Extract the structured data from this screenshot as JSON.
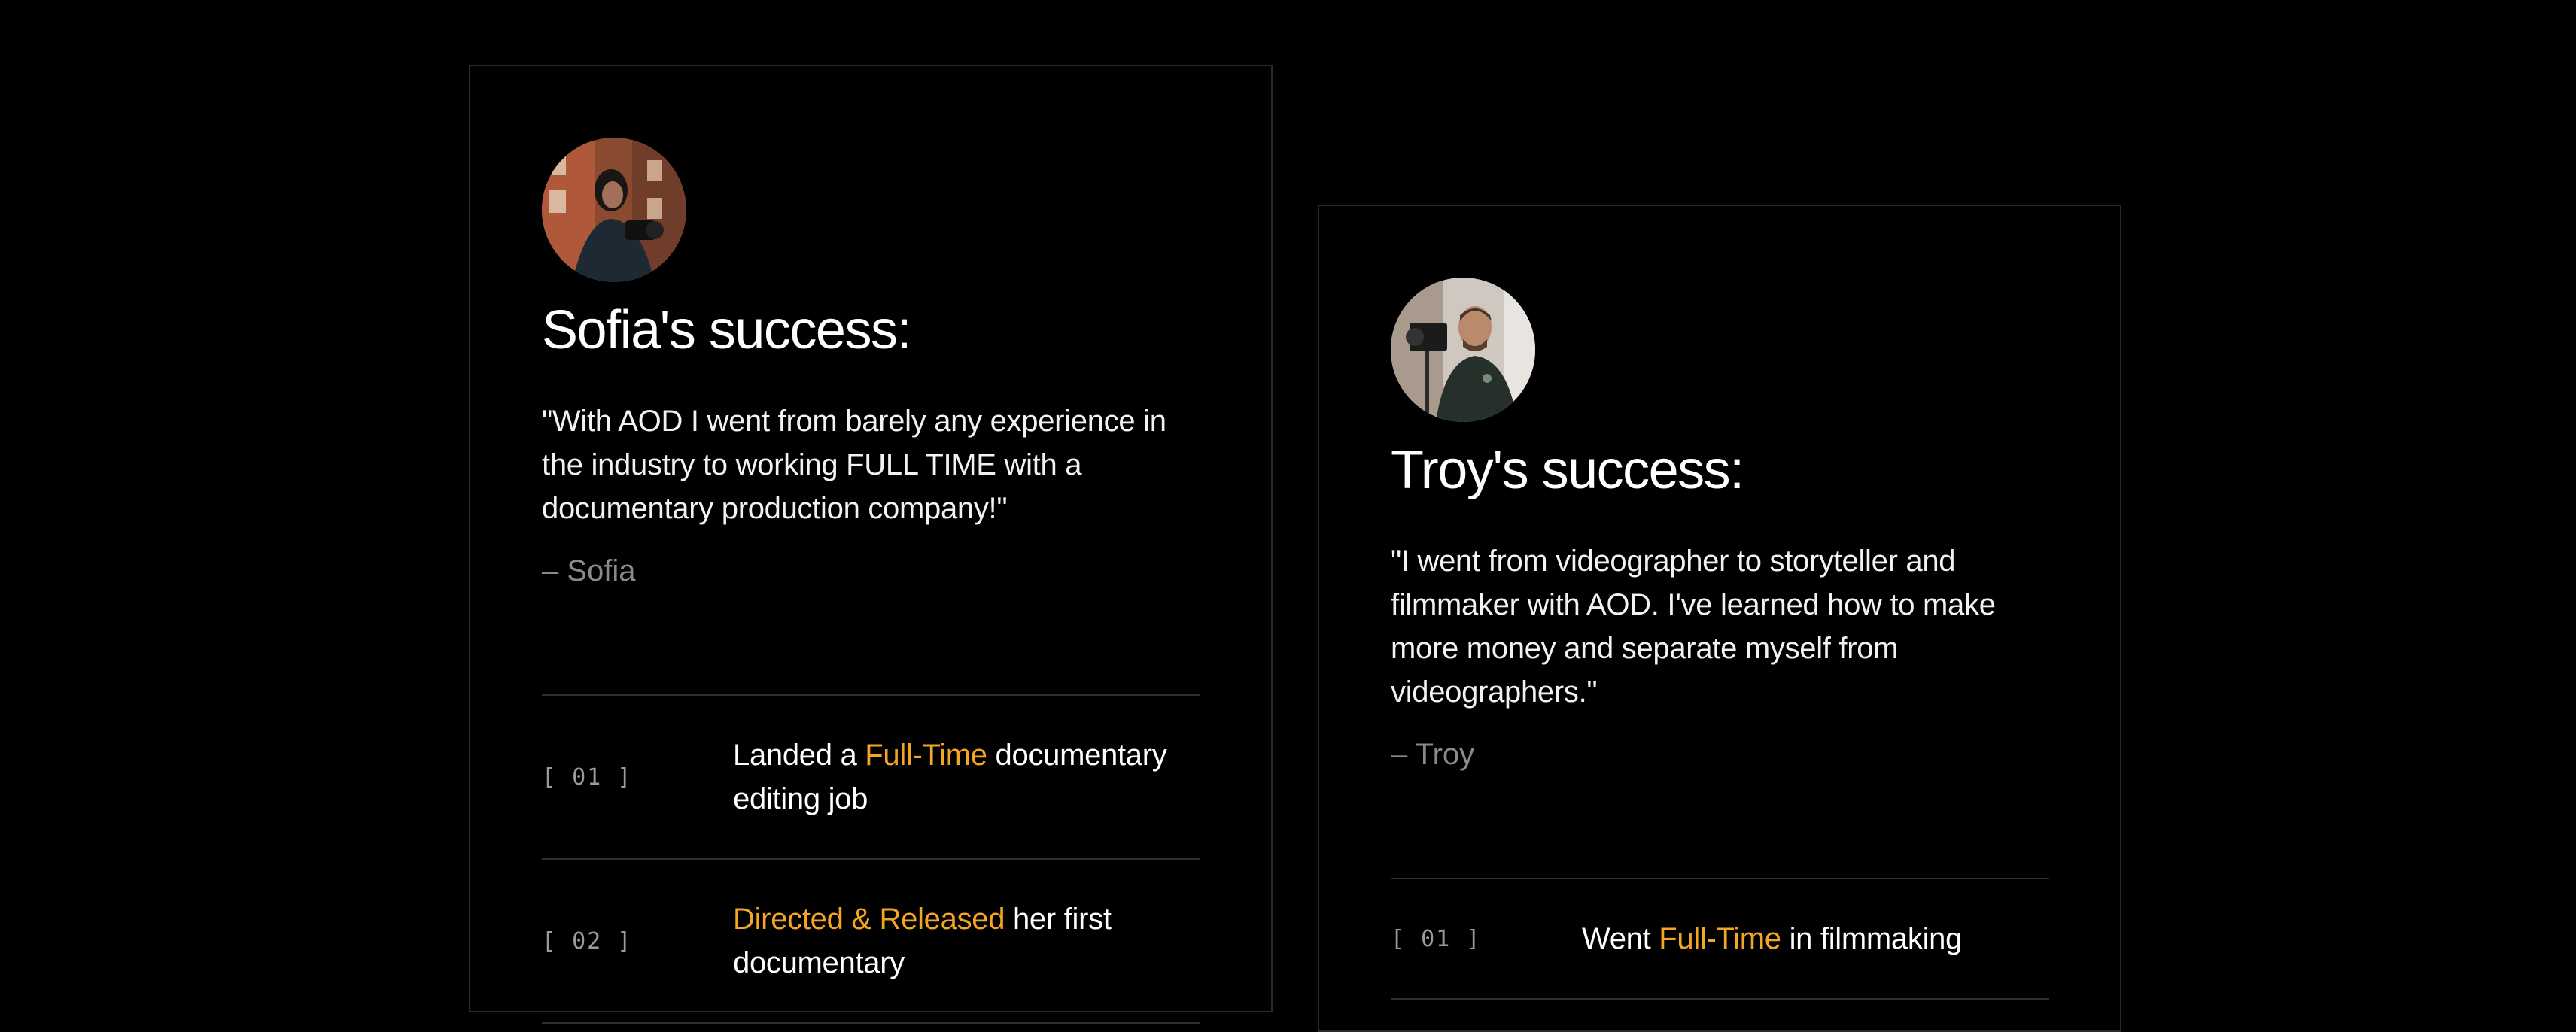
{
  "colors": {
    "background": "#000000",
    "accent": "#f5a524",
    "muted": "#8a8a8a",
    "border": "#2a2a2a"
  },
  "cards": [
    {
      "avatar_icon": "person-with-camera-photo",
      "headline": "Sofia's success:",
      "quote": "\"With AOD I went from barely any experience in the industry to working FULL TIME with a documentary production company!\"",
      "author": "– Sofia",
      "milestones": [
        {
          "num": "[ 01 ]",
          "before": "Landed a ",
          "highlight": "Full-Time",
          "after": " documentary editing job"
        },
        {
          "num": "[ 02 ]",
          "before": "",
          "highlight": "Directed & Released",
          "after": " her first documentary"
        }
      ]
    },
    {
      "avatar_icon": "person-with-cinema-camera-photo",
      "headline": "Troy's success:",
      "quote": "\"I went from videographer to storyteller and filmmaker with AOD. I've learned how to make more money and separate myself from videographers.\"",
      "author": "– Troy",
      "milestones": [
        {
          "num": "[ 01 ]",
          "before": "Went ",
          "highlight": "Full-Time",
          "after": " in filmmaking"
        }
      ]
    }
  ]
}
